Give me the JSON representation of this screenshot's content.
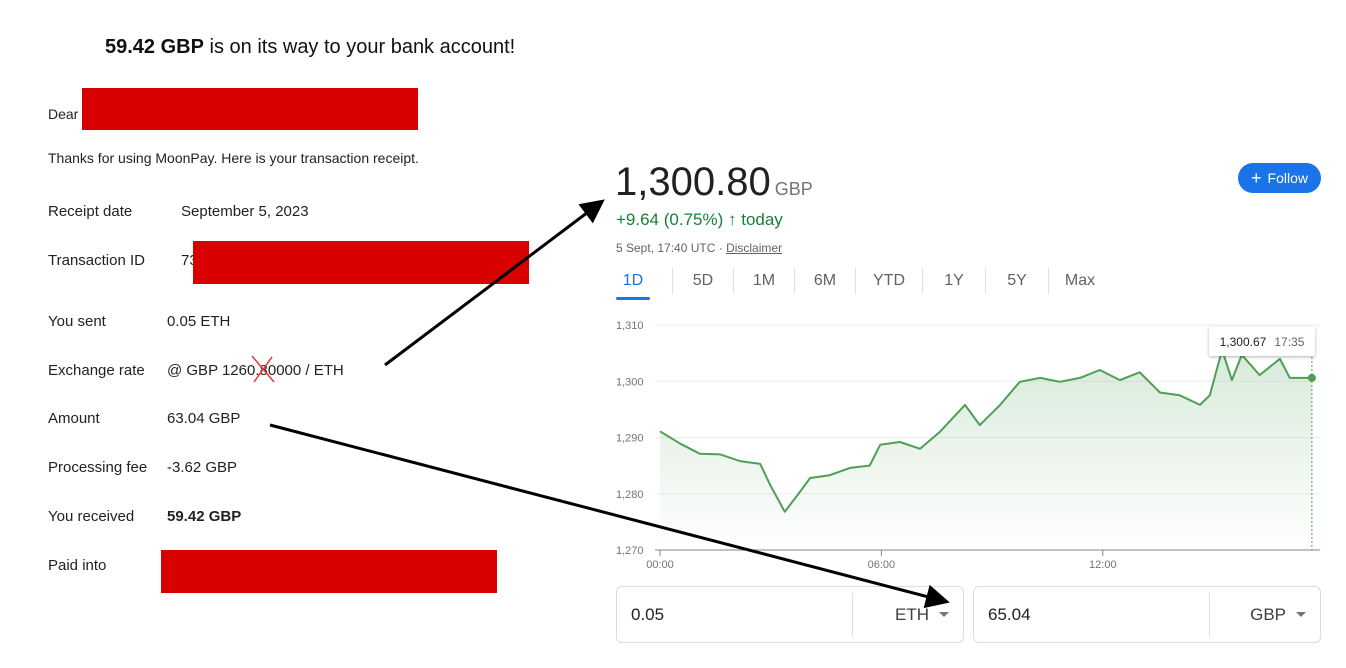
{
  "headline": {
    "amount": "59.42 GBP",
    "rest": " is on its way to your bank account!"
  },
  "receipt": {
    "dear": "Dear",
    "thanks": "Thanks for using MoonPay. Here is your transaction receipt.",
    "rows": [
      {
        "label": "Receipt date",
        "value": "September 5, 2023"
      },
      {
        "label": "Transaction ID",
        "value": "73"
      },
      {
        "label": "You sent",
        "value": "0.05 ETH"
      },
      {
        "label": "Exchange rate",
        "value": "@ GBP 1260.80000 / ETH"
      },
      {
        "label": "Amount",
        "value": "63.04 GBP"
      },
      {
        "label": "Processing fee",
        "value": "-3.62 GBP"
      },
      {
        "label": "You received",
        "value": "59.42 GBP"
      },
      {
        "label": "Paid into",
        "value": ""
      }
    ],
    "redaction_color": "#d90000"
  },
  "quote": {
    "price": "1,300.80",
    "currency": "GBP",
    "change": "+9.64 (0.75%)",
    "change_arrow": "arrow-up-icon",
    "change_suffix": "today",
    "timestamp": "5 Sept, 17:40 UTC · ",
    "disclaimer": "Disclaimer",
    "follow": "Follow",
    "tabs": [
      "1D",
      "5D",
      "1M",
      "6M",
      "YTD",
      "1Y",
      "5Y",
      "Max"
    ],
    "active_tab": "1D",
    "tooltip": {
      "value": "1,300.67",
      "time": "17:35"
    },
    "accent": "#1a73e8",
    "positive": "#188038"
  },
  "converter": {
    "from": {
      "value": "0.05",
      "unit": "ETH"
    },
    "to": {
      "value": "65.04",
      "unit": "GBP"
    }
  },
  "chart_data": {
    "type": "line",
    "ylim": [
      1270,
      1310
    ],
    "yticks": [
      "1,310",
      "1,300",
      "1,290",
      "1,280",
      "1,270"
    ],
    "xticks": [
      "00:00",
      "06:00",
      "12:00"
    ],
    "grid": true,
    "color": "#4e9f56",
    "x": [
      "00:00",
      "00:33",
      "01:05",
      "01:38",
      "02:10",
      "02:43",
      "02:59",
      "03:23",
      "03:48",
      "04:04",
      "04:36",
      "05:09",
      "05:41",
      "05:58",
      "06:30",
      "07:03",
      "07:35",
      "08:16",
      "08:40",
      "09:13",
      "09:45",
      "10:18",
      "10:50",
      "11:23",
      "11:55",
      "12:28",
      "13:00",
      "13:33",
      "14:05",
      "14:38",
      "14:54",
      "15:14",
      "15:30",
      "15:46",
      "16:15",
      "16:48",
      "17:04",
      "17:40"
    ],
    "y": [
      1291.1,
      1288.9,
      1287.1,
      1287,
      1285.8,
      1285.3,
      1281.6,
      1276.8,
      1280.4,
      1282.8,
      1283.3,
      1284.6,
      1285,
      1288.7,
      1289.2,
      1288,
      1291,
      1295.8,
      1292.2,
      1295.8,
      1299.9,
      1300.6,
      1299.9,
      1300.6,
      1302,
      1300.2,
      1301.6,
      1298,
      1297.5,
      1295.8,
      1297.5,
      1305.6,
      1300.2,
      1304.7,
      1301.1,
      1304,
      1300.6,
      1300.6
    ]
  }
}
